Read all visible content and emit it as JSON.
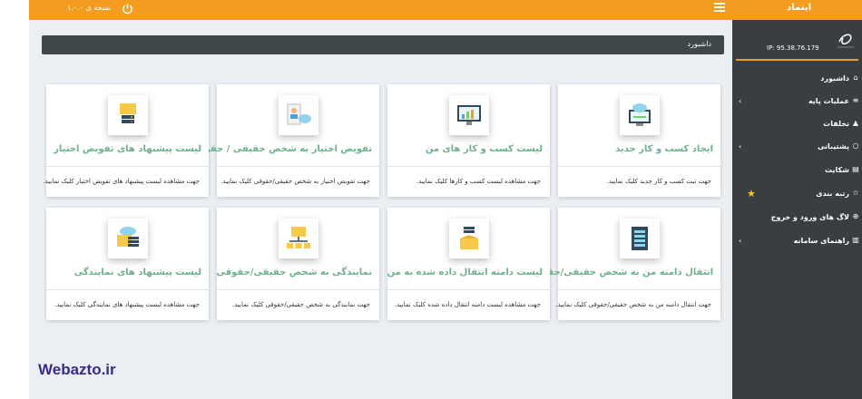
{
  "header": {
    "title": "ایتماد",
    "version_text": "نسخه ی ۱.۰.۰"
  },
  "breadcrumb": {
    "label": "داشبورد"
  },
  "cards": [
    {
      "title": "ایجاد کسب و کار جدید",
      "desc": "جهت ثبت کسب و کار جدید کلیک نمایید.",
      "icon": "cloud-monitor-icon"
    },
    {
      "title": "لیست کسب و کار های من",
      "desc": "جهت مشاهده لیست کسب و کارها کلیک نمایید.",
      "icon": "chart-monitor-icon"
    },
    {
      "title": "تفویض اختیار به شخص حقیقی / حقوقی",
      "desc": "جهت تفویض اختیار به شخص حقیقی/حقوقی کلیک نمایید.",
      "icon": "user-cloud-icon"
    },
    {
      "title": "لیست پیشنهاد های تفویض اختیار",
      "desc": "جهت مشاهده لیست پیشنهاد های تفویض اختیار کلیک نمایید.",
      "icon": "folder-server-icon"
    },
    {
      "title": "انتقال دامنه من به شخص حقیقی/حقوقی",
      "desc": "جهت انتقال دامنه من به شخص حقیقی/حقوقی کلیک نمایید.",
      "icon": "server-list-icon"
    },
    {
      "title": "لیست دامنه انتقال داده شده به من",
      "desc": "جهت مشاهده لیست دامنه انتقال داده شده کلیک نمایید.",
      "icon": "box-server-icon"
    },
    {
      "title": "نمایندگی به شخص حقیقی/حقوقی",
      "desc": "جهت نمایندگی به شخص حقیقی/حقوقی کلیک نمایید.",
      "icon": "folder-network-icon"
    },
    {
      "title": "لیست پیشنهاد های نمایندگی",
      "desc": "جهت مشاهده لیست پیشنهاد های نمایندگی کلیک نمایید.",
      "icon": "folder-cloud-icon"
    }
  ],
  "sidebar": {
    "ip": "IP: 95.38.76.179",
    "items": [
      {
        "label": "داشبورد",
        "icon": "home-icon",
        "chevron": false
      },
      {
        "label": "عملیات پایه",
        "icon": "list-icon",
        "chevron": true
      },
      {
        "label": "تخلفات",
        "icon": "warning-icon",
        "chevron": false
      },
      {
        "label": "پشتیبانی",
        "icon": "chat-icon",
        "chevron": true
      },
      {
        "label": "شکایت",
        "icon": "document-icon",
        "chevron": false
      },
      {
        "label": "رتبه بندی",
        "icon": "star-outline-icon",
        "chevron": false,
        "star": true
      },
      {
        "label": "لاگ های ورود و خروج",
        "icon": "plus-circle-icon",
        "chevron": false
      },
      {
        "label": "راهنمای سامانه",
        "icon": "book-icon",
        "chevron": true
      }
    ]
  },
  "watermark": "Webazto.ir",
  "colors": {
    "accent": "#f39c1f",
    "sidebar": "#393f41",
    "card_title": "#6fb18c",
    "background": "#ebeff3"
  }
}
